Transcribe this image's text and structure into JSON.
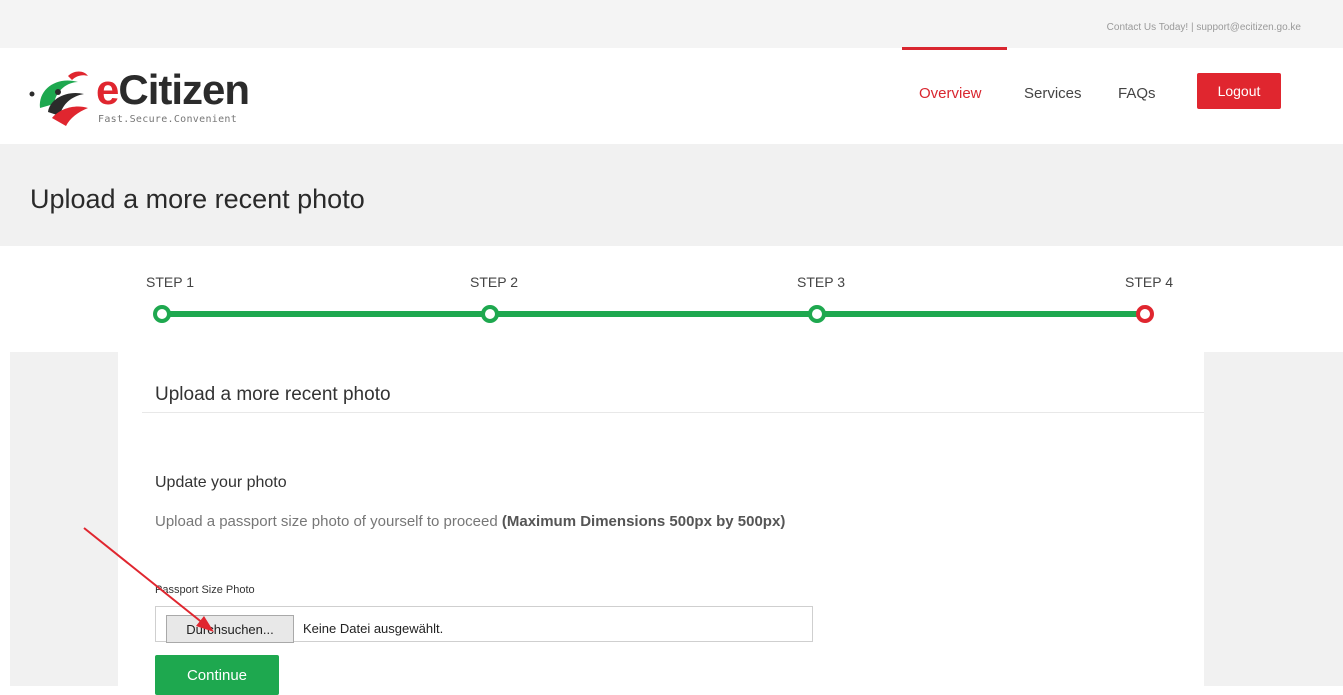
{
  "topbar": {
    "contact": "Contact Us Today! | support@ecitizen.go.ke"
  },
  "brand": {
    "name_prefix": "e",
    "name_rest": "Citizen",
    "tagline": "Fast.Secure.Convenient"
  },
  "nav": {
    "items": [
      {
        "label": "Overview",
        "active": true
      },
      {
        "label": "Services",
        "active": false
      },
      {
        "label": "FAQs",
        "active": false
      }
    ],
    "logout_label": "Logout"
  },
  "page": {
    "title": "Upload a more recent photo"
  },
  "steps": {
    "items": [
      {
        "label": "STEP 1",
        "state": "done"
      },
      {
        "label": "STEP 2",
        "state": "done"
      },
      {
        "label": "STEP 3",
        "state": "done"
      },
      {
        "label": "STEP 4",
        "state": "current"
      }
    ]
  },
  "card": {
    "title": "Upload a more recent photo",
    "section_heading": "Update your photo",
    "description_text": "Upload a passport size photo of yourself to proceed ",
    "description_bold": "(Maximum Dimensions 500px by 500px)",
    "field_label": "Passport Size Photo",
    "file_button_label": "Durchsuchen...",
    "file_status": "Keine Datei ausgewählt.",
    "continue_label": "Continue"
  },
  "colors": {
    "brand_red": "#e0262f",
    "brand_green": "#1ea84f",
    "band_gray": "#f1f1f1"
  },
  "icons": {
    "logo": "ecitizen-logo-icon",
    "annotation": "red-arrow-icon"
  }
}
